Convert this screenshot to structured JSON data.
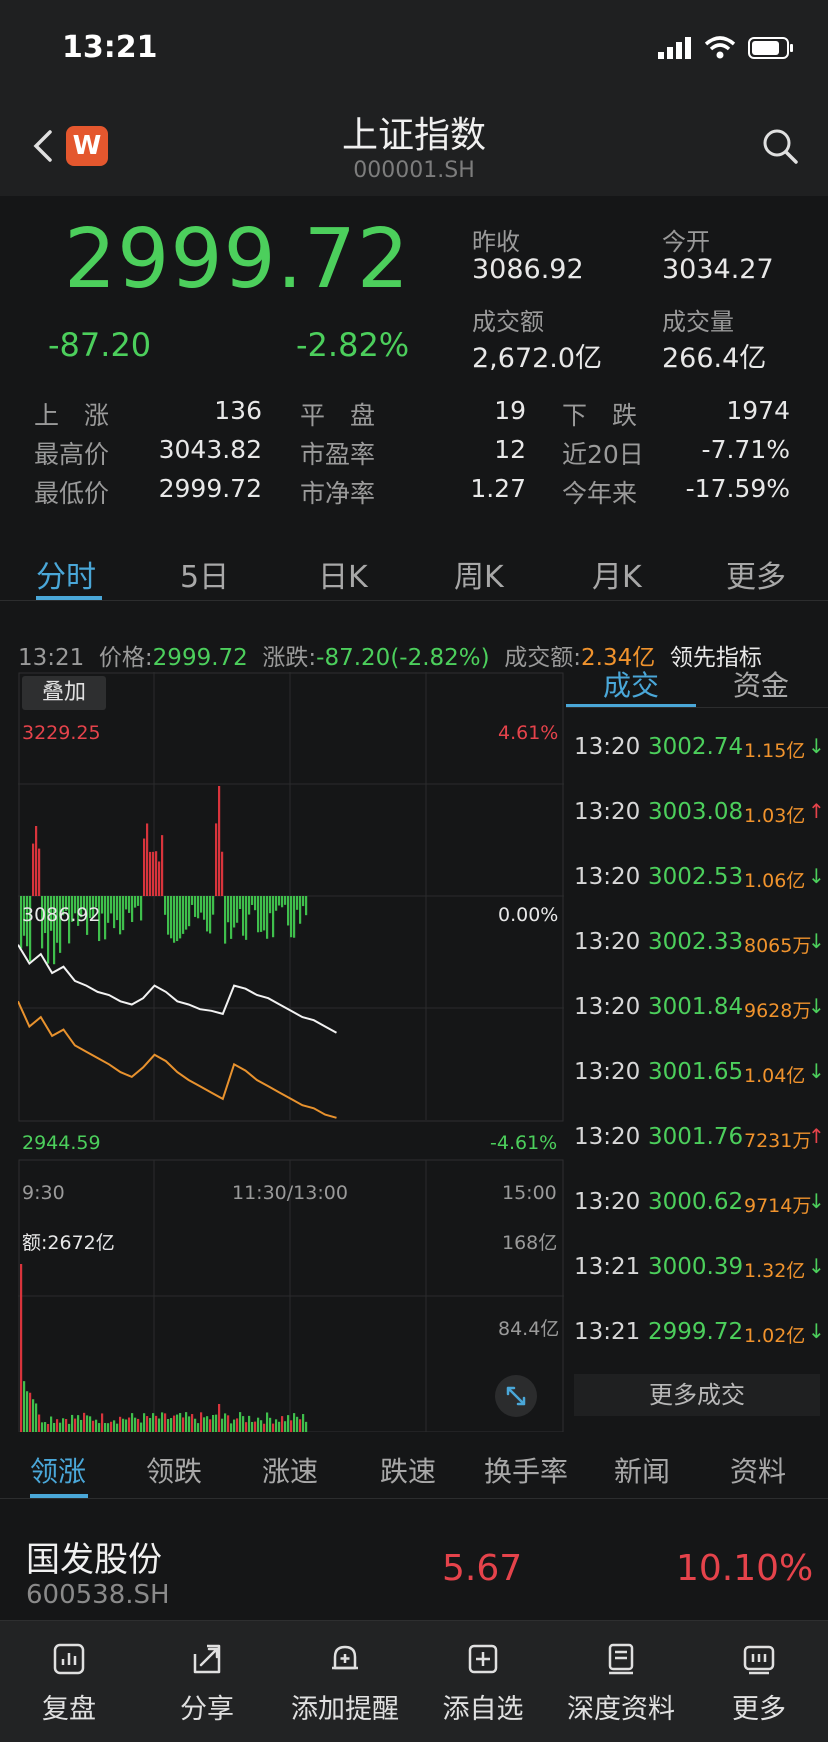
{
  "status": {
    "time": "13:21"
  },
  "header": {
    "logo": "W",
    "title": "上证指数",
    "code": "000001.SH"
  },
  "quote": {
    "price": "2999.72",
    "change": "-87.20",
    "change_pct": "-2.82%",
    "prev_close_label": "昨收",
    "prev_close": "3086.92",
    "open_label": "今开",
    "open": "3034.27",
    "turnover_label": "成交额",
    "turnover": "2,672.0亿",
    "volume_label": "成交量",
    "volume": "266.4亿"
  },
  "stats": [
    {
      "label": "上　涨",
      "value": "136"
    },
    {
      "label": "平　盘",
      "value": "19"
    },
    {
      "label": "下　跌",
      "value": "1974"
    },
    {
      "label": "最高价",
      "value": "3043.82"
    },
    {
      "label": "市盈率",
      "value": "12"
    },
    {
      "label": "近20日",
      "value": "-7.71%"
    },
    {
      "label": "最低价",
      "value": "2999.72"
    },
    {
      "label": "市净率",
      "value": "1.27"
    },
    {
      "label": "今年来",
      "value": "-17.59%"
    }
  ],
  "chart_tabs": [
    "分时",
    "5日",
    "日K",
    "周K",
    "月K",
    "更多"
  ],
  "info": {
    "time": "13:21",
    "price_label": "价格:",
    "price": "2999.72",
    "change_label": "涨跌:",
    "change": "-87.20(-2.82%)",
    "amount_label": "成交额:",
    "amount": "2.34亿",
    "indicator": "领先指标"
  },
  "chart": {
    "overlay": "叠加",
    "y_top": "3229.25",
    "y_mid": "3086.92",
    "y_bot": "2944.59",
    "pct_top": "4.61%",
    "pct_mid": "0.00%",
    "pct_bot": "-4.61%",
    "x_start": "9:30",
    "x_mid": "11:30/13:00",
    "x_end": "15:00",
    "vol_label": "额:2672亿",
    "vol_top": "168亿",
    "vol_mid": "84.4亿"
  },
  "chart_data": {
    "type": "line",
    "series": [],
    "ylim": [
      2944.59,
      3229.25
    ],
    "prev_close": 3086.92,
    "note_series": [
      {
        "values": [
          3056,
          3044,
          3050,
          3038,
          3042,
          3033,
          3030,
          3026,
          3024,
          3020,
          3018,
          3022,
          3030,
          3026,
          3020,
          3018,
          3015,
          3014,
          3012,
          3030,
          3028,
          3024,
          3022,
          3018,
          3014,
          3010,
          3008,
          3004,
          3000
        ]
      },
      {
        "values": [
          3020,
          3004,
          3010,
          2998,
          3002,
          2992,
          2988,
          2984,
          2980,
          2975,
          2972,
          2978,
          2986,
          2982,
          2975,
          2970,
          2966,
          2962,
          2958,
          2980,
          2976,
          2970,
          2966,
          2962,
          2958,
          2954,
          2952,
          2948,
          2946
        ]
      }
    ]
  },
  "trades": {
    "tab_trades": "成交",
    "tab_funds": "资金",
    "rows": [
      {
        "time": "13:20",
        "price": "3002.74",
        "vol": "1.15亿",
        "dir": "↓"
      },
      {
        "time": "13:20",
        "price": "3003.08",
        "vol": "1.03亿",
        "dir": "↑"
      },
      {
        "time": "13:20",
        "price": "3002.53",
        "vol": "1.06亿",
        "dir": "↓"
      },
      {
        "time": "13:20",
        "price": "3002.33",
        "vol": "8065万",
        "dir": "↓"
      },
      {
        "time": "13:20",
        "price": "3001.84",
        "vol": "9628万",
        "dir": "↓"
      },
      {
        "time": "13:20",
        "price": "3001.65",
        "vol": "1.04亿",
        "dir": "↓"
      },
      {
        "time": "13:20",
        "price": "3001.76",
        "vol": "7231万",
        "dir": "↑"
      },
      {
        "time": "13:20",
        "price": "3000.62",
        "vol": "9714万",
        "dir": "↓"
      },
      {
        "time": "13:21",
        "price": "3000.39",
        "vol": "1.32亿",
        "dir": "↓"
      },
      {
        "time": "13:21",
        "price": "2999.72",
        "vol": "1.02亿",
        "dir": "↓"
      }
    ],
    "more": "更多成交"
  },
  "bottom_tabs": [
    "领涨",
    "领跌",
    "涨速",
    "跌速",
    "换手率",
    "新闻",
    "资料"
  ],
  "top_stock": {
    "name": "国发股份",
    "code": "600538.SH",
    "price": "5.67",
    "pct": "10.10%"
  },
  "toolbar": [
    {
      "label": "复盘",
      "icon": "chart-box-icon"
    },
    {
      "label": "分享",
      "icon": "share-icon"
    },
    {
      "label": "添加提醒",
      "icon": "bell-plus-icon"
    },
    {
      "label": "添自选",
      "icon": "plus-box-icon"
    },
    {
      "label": "深度资料",
      "icon": "book-icon"
    },
    {
      "label": "更多",
      "icon": "more-box-icon"
    }
  ]
}
